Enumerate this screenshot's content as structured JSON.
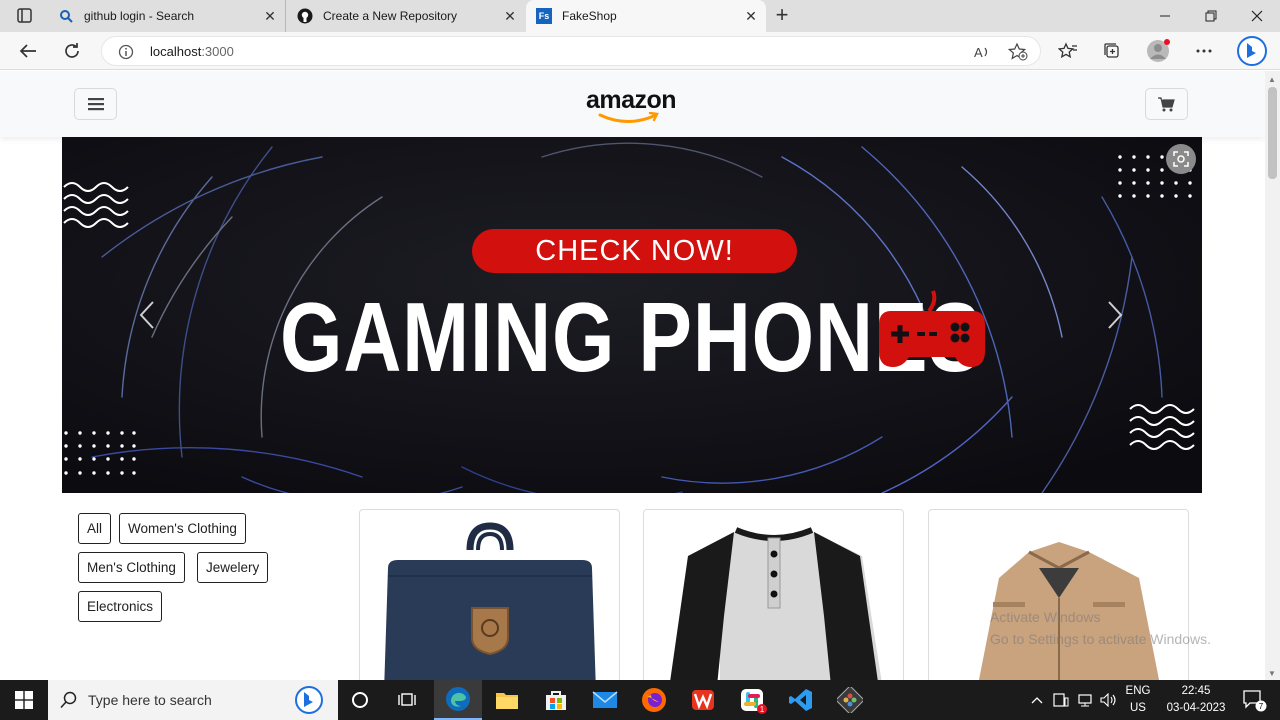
{
  "browser": {
    "tabs": [
      {
        "title": "github login - Search",
        "icon": "search-icon"
      },
      {
        "title": "Create a New Repository",
        "icon": "github-icon"
      },
      {
        "title": "FakeShop",
        "icon": "fakeshop-icon",
        "favicon_text": "Fs"
      }
    ],
    "address": {
      "host": "localhost",
      "port": ":3000"
    }
  },
  "site": {
    "logo_text": "amazon",
    "banner": {
      "cta": "CHECK NOW!",
      "headline": "GAMING PHONES"
    },
    "categories": [
      "All",
      "Women's Clothing",
      "Men's Clothing",
      "Jewelery",
      "Electronics"
    ],
    "products": [
      {
        "kind": "backpack",
        "color": "#2a3b57"
      },
      {
        "kind": "henley-shirt",
        "color": "#d9d9d9"
      },
      {
        "kind": "jacket",
        "color": "#c9a27e"
      }
    ]
  },
  "os_watermark": {
    "line1": "Activate Windows",
    "line2": "Go to Settings to activate Windows."
  },
  "taskbar": {
    "search_placeholder": "Type here to search",
    "lang": "ENG",
    "region": "US",
    "time": "22:45",
    "date": "03-04-2023",
    "notification_count": "7",
    "slack_badge": "1"
  },
  "colors": {
    "accent_red": "#d2110f",
    "amazon_orange": "#ff9900",
    "edge_blue": "#0f6cbd"
  }
}
